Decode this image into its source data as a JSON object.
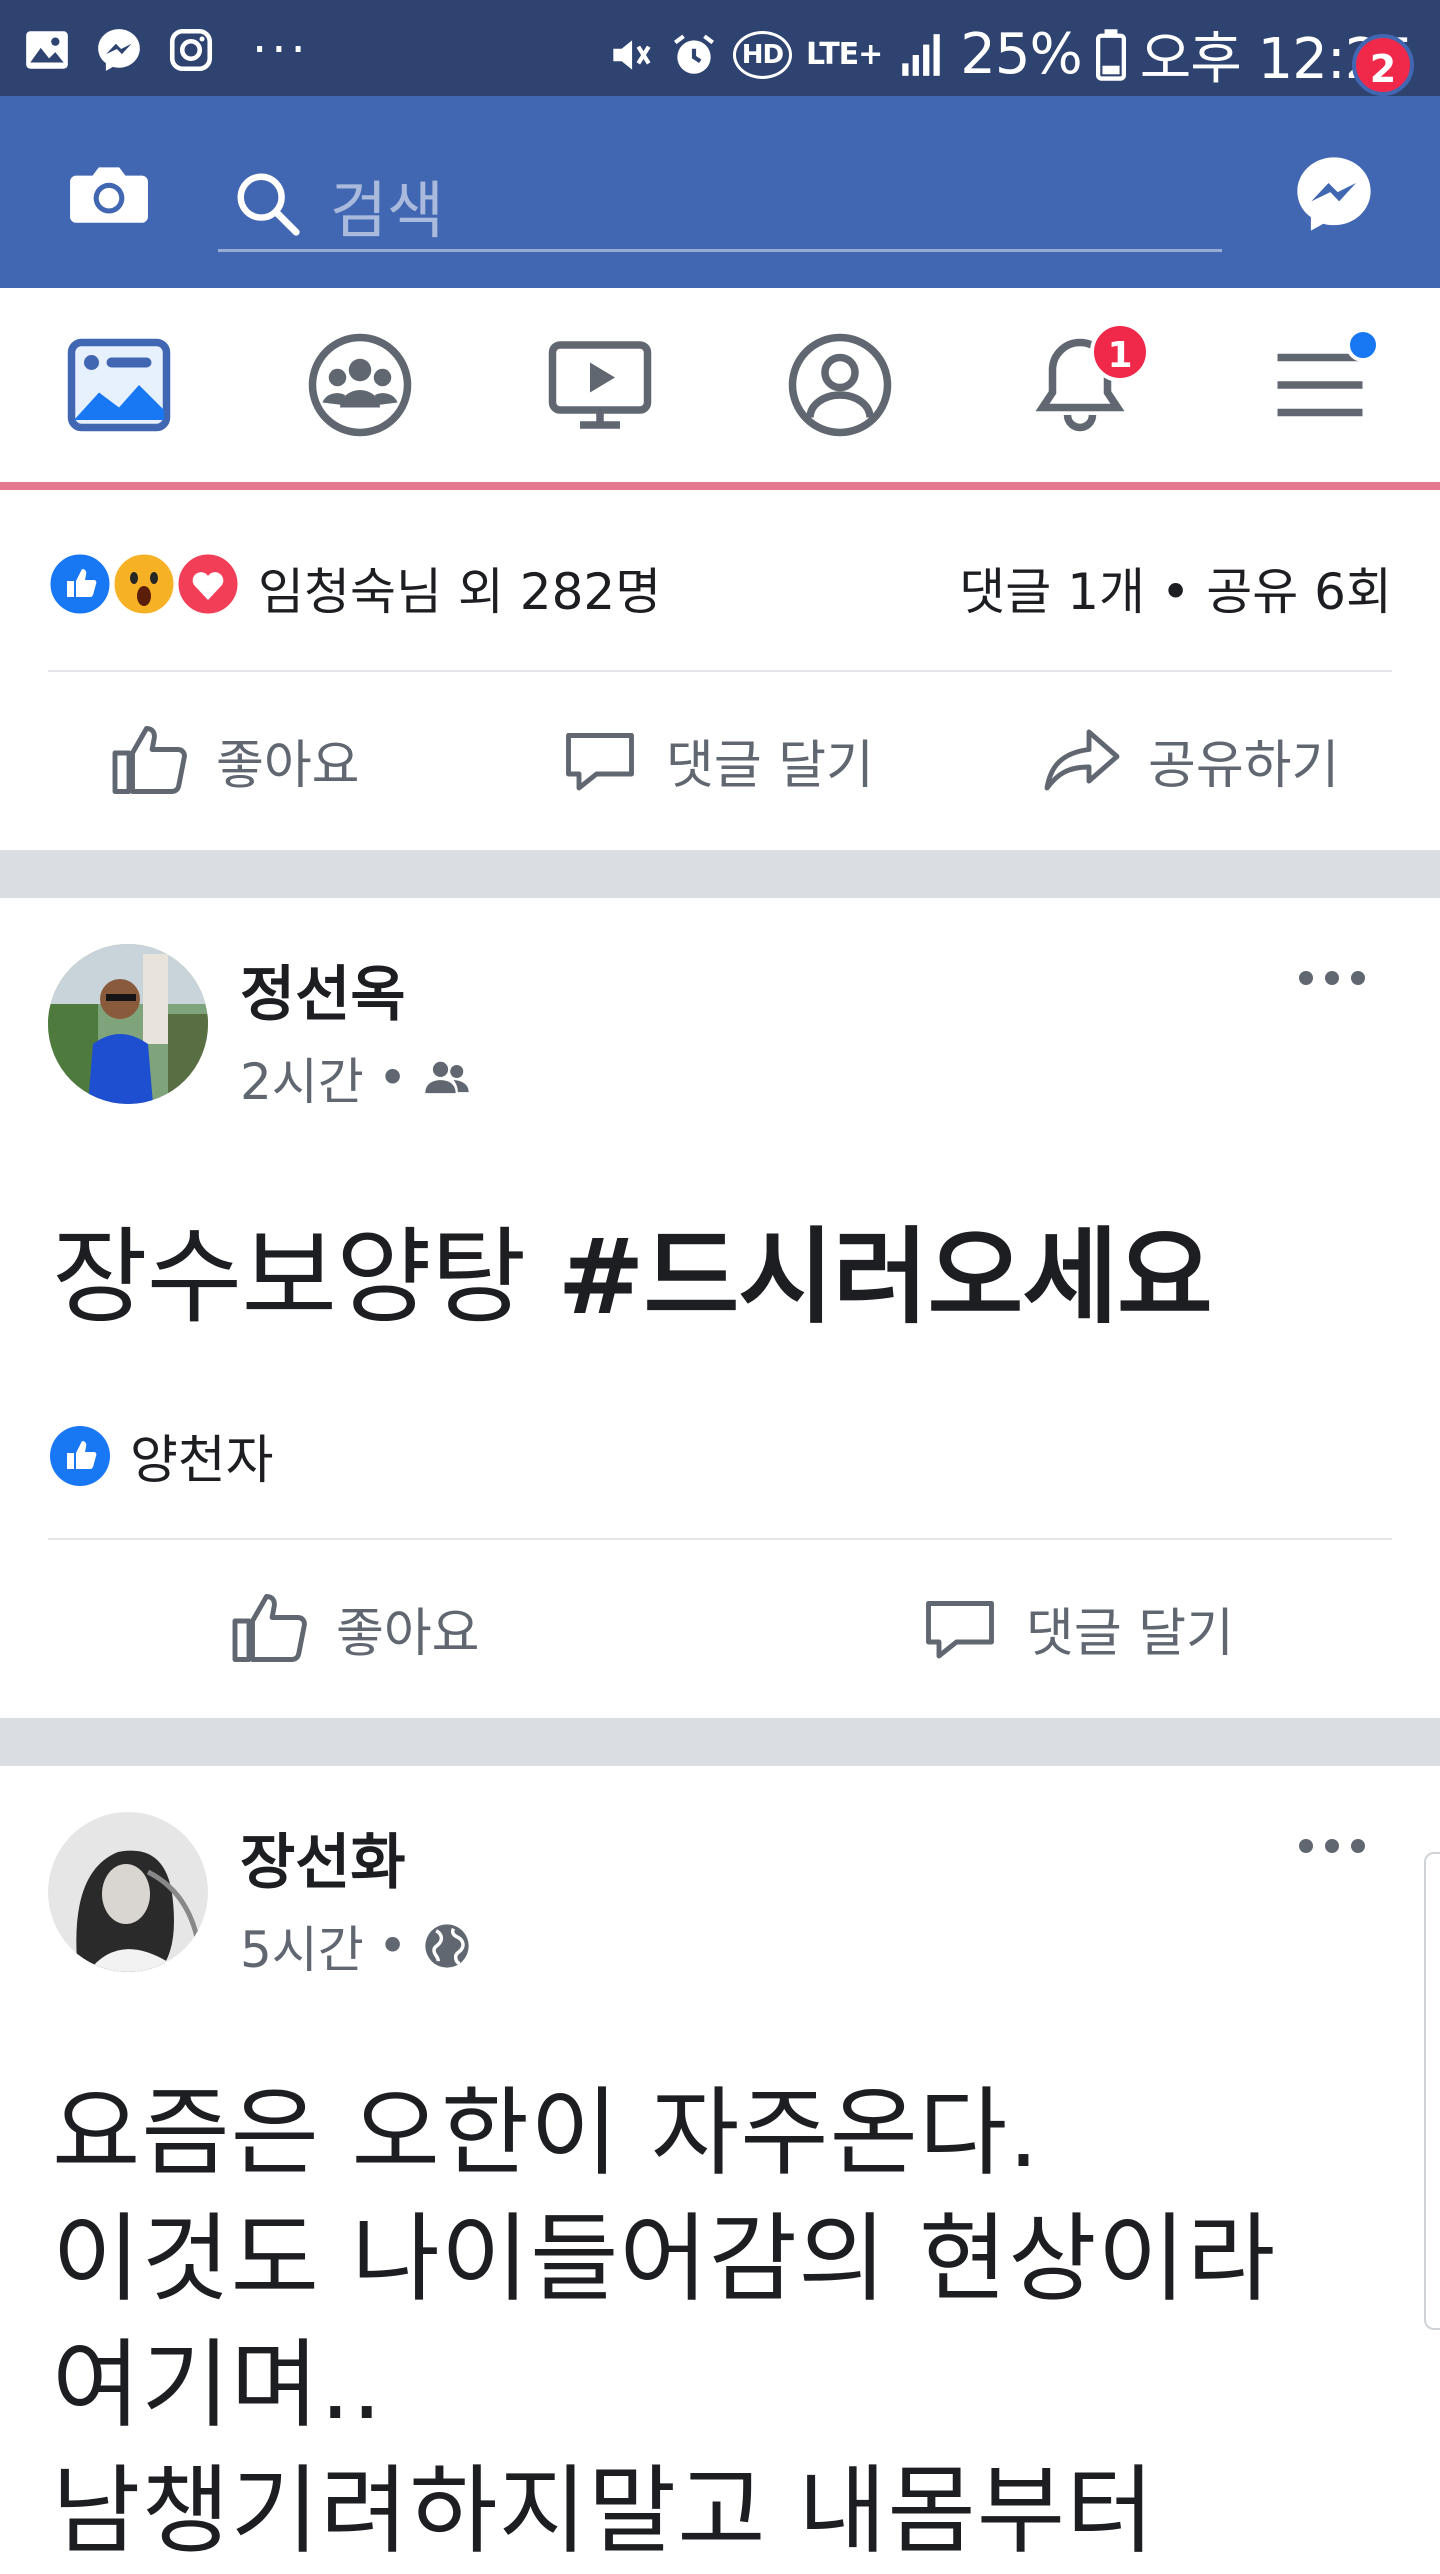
{
  "status_bar": {
    "left_icons": [
      "gallery-icon",
      "messenger-icon",
      "instagram-icon",
      "more-dots"
    ],
    "more_dots": "···",
    "battery": "25%",
    "time": "오후 12:25",
    "network": "LTE+",
    "hd": "HD"
  },
  "header": {
    "search_placeholder": "검색",
    "messenger_badge": "2"
  },
  "tabs": {
    "items": [
      "news-feed",
      "groups",
      "watch",
      "profile",
      "notifications",
      "menu"
    ],
    "notifications_badge": "1",
    "accent_color": "#4267b2"
  },
  "post_prev": {
    "reaction_names": "임청숙님 외 282명",
    "stats": "댓글 1개 • 공유 6회",
    "actions": {
      "like": "좋아요",
      "comment": "댓글 달기",
      "share": "공유하기"
    }
  },
  "post1": {
    "author": "정선옥",
    "time": "2시간",
    "audience_icon": "friends-icon",
    "text_plain": "장수보양탕 ",
    "text_tag": "#드시러오세요",
    "liker": "양천자",
    "actions": {
      "like": "좋아요",
      "comment": "댓글 달기"
    }
  },
  "post2": {
    "author": "장선화",
    "time": "5시간",
    "audience_icon": "globe-icon",
    "lines": [
      "요즘은 오한이 자주온다.",
      "이것도 나이들어감의 현상이라",
      "여기며..",
      "남챙기려하지말고 내몸부터"
    ]
  }
}
